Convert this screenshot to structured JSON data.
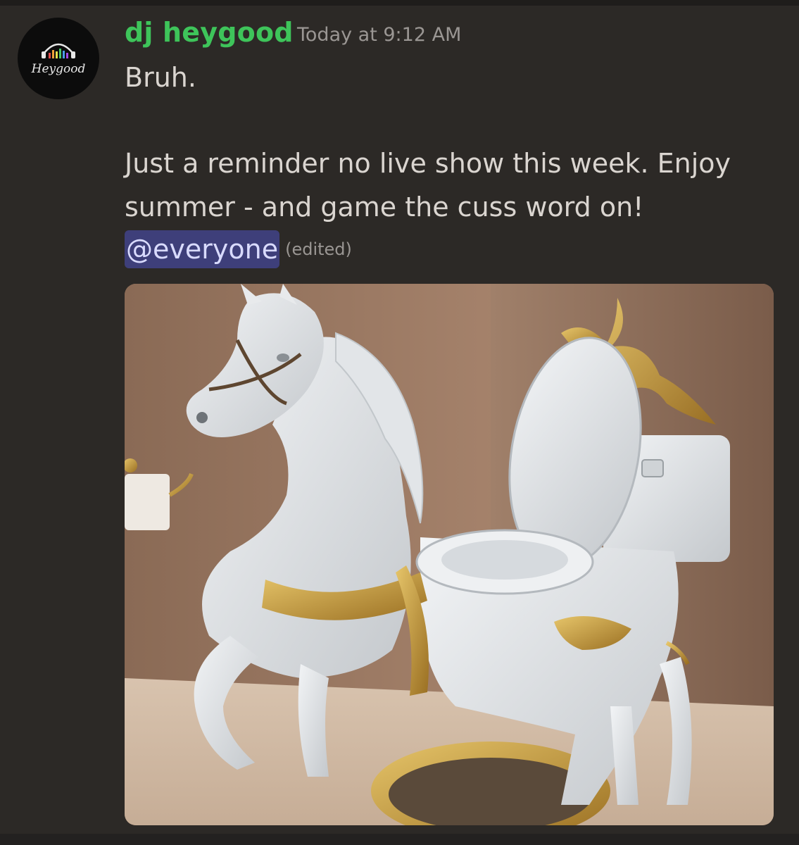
{
  "author": {
    "username": "dj heygood",
    "avatar_text": "Heygood",
    "avatar_icon": "headphones-equalizer-icon"
  },
  "timestamp": "Today at 9:12 AM",
  "message": {
    "line1": "Bruh.",
    "line2": "Just a reminder no live show this week.  Enjoy",
    "line3": "summer - and game the cuss word on!",
    "mention": "@everyone",
    "edited_label": "(edited)"
  },
  "colors": {
    "username": "#3ec45a",
    "mention_bg": "#3e3f7a",
    "background": "#2c2926"
  }
}
